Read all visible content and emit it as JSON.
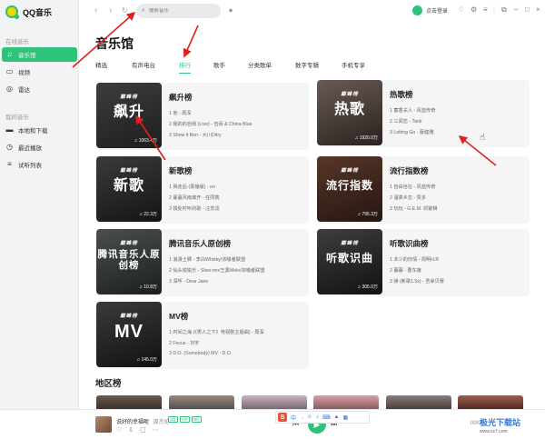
{
  "app": {
    "name": "QQ音乐"
  },
  "sidebar": {
    "section_online": "在线音乐",
    "online_items": [
      {
        "label": "音乐馆",
        "icon": "music-note-icon"
      },
      {
        "label": "视频",
        "icon": "video-icon"
      },
      {
        "label": "雷达",
        "icon": "radar-icon"
      }
    ],
    "section_mine": "我的音乐",
    "mine_items": [
      {
        "label": "本地和下载",
        "icon": "computer-icon"
      },
      {
        "label": "最近播放",
        "icon": "clock-icon"
      },
      {
        "label": "试听列表",
        "icon": "playlist-icon"
      }
    ]
  },
  "topbar": {
    "search_placeholder": "搜索音乐",
    "login_label": "点击登录"
  },
  "page": {
    "title": "音乐馆",
    "tabs": [
      "精选",
      "有声电台",
      "排行",
      "歌手",
      "分类歌单",
      "数字专辑",
      "手机专享"
    ],
    "active_tab": "排行"
  },
  "cover_brand": "巅峰榜",
  "charts": [
    {
      "name": "飙升榜",
      "cover_text": "飙升",
      "count": "1063.4万",
      "cover_colors": [
        "#3d3d3d",
        "#1e1e1e"
      ],
      "songs": [
        "1 他 - 周深",
        "2 我的的自我 (Live) - 伍佰 & China Blue",
        "3 Show it Ben - 大川Ditry"
      ]
    },
    {
      "name": "热歌榜",
      "cover_text": "热歌",
      "count": "1920.0万",
      "cover_colors": [
        "#6a5a52",
        "#2a2320"
      ],
      "songs": [
        "1 蓄香夫人 - 风蓝传奇",
        "2 三闻恋 - Tank",
        "3 Letting Go - 蔡健雅"
      ]
    },
    {
      "name": "新歌榜",
      "cover_text": "新歌",
      "count": "22.3万",
      "cover_colors": [
        "#3a3a3a",
        "#151515"
      ],
      "songs": [
        "1 我走后 (录播版) - en",
        "2 蔓蔓风雨离开 - 任同携",
        "3 独处时听的歌 - 汪苏泷"
      ]
    },
    {
      "name": "流行指数榜",
      "cover_text": "流行指数",
      "count": "795.3万",
      "cover_colors": [
        "#5a3628",
        "#241612"
      ],
      "songs": [
        "1 自由自在 - 风蓝传奇",
        "2 温柔乡恋 - 赞多",
        "3 玩玩 - G.E.M. 邓紫棋"
      ]
    },
    {
      "name": "腾讯音乐人原创榜",
      "cover_text": "腾讯音乐人原创榜",
      "count": "10.8万",
      "cover_colors": [
        "#4a4f4c",
        "#1c1f1e"
      ],
      "songs": [
        "1 浪漫土狮 - 李白Whisky/浓嗓者联盟",
        "2 仙头锐锐乐 - Slow-mo/王黑Melo/浓嗓者联盟",
        "3 深呼 - Dear Jane"
      ]
    },
    {
      "name": "听歌识曲榜",
      "cover_text": "听歌识曲",
      "count": "305.0万",
      "cover_colors": [
        "#3e3e3e",
        "#121212"
      ],
      "songs": [
        "1 本少的你情 - 周明H.R",
        "2 暮暮 - 曹东旗",
        "3 弹 (新歌1.5x) - 吾拿贝赛"
      ]
    },
    {
      "name": "MV榜",
      "cover_text": "MV",
      "count": "145.0万",
      "cover_colors": [
        "#3b3b3b",
        "#111111"
      ],
      "songs": [
        "1 时间之海 (《男人之下》电视剧主题曲) - 周深",
        "2 Focus - 刘宇",
        "3 D.O. (Somebody) MV - D.O."
      ]
    }
  ],
  "region": {
    "title": "地区榜"
  },
  "player": {
    "title": "说好的幸福呢",
    "artist": "周杰伦",
    "tags": [
      "SQ",
      "VIP",
      "MV"
    ],
    "right_label": "00/04"
  },
  "ime": {
    "lang": "中"
  },
  "watermark": {
    "main": "极光下载站",
    "sub": "www.xz7.com"
  }
}
